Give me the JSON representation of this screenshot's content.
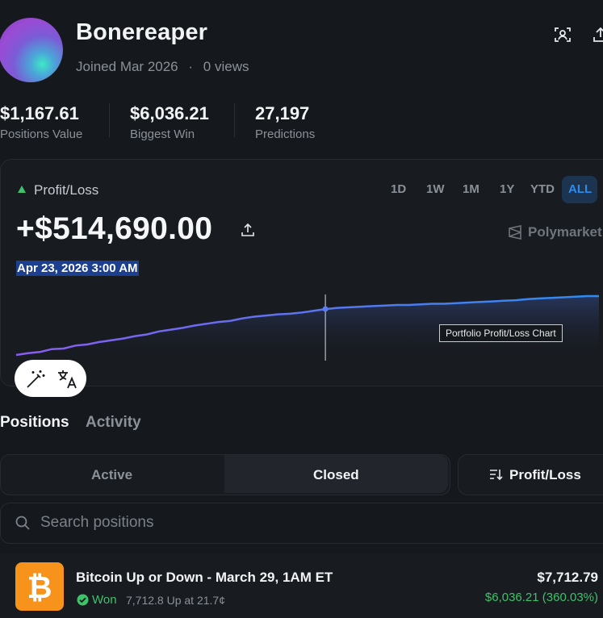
{
  "profile": {
    "username": "Bonereaper",
    "joined": "Joined Mar 2026",
    "separator": "·",
    "views": "0 views"
  },
  "stats": [
    {
      "value": "$1,167.61",
      "label": "Positions Value"
    },
    {
      "value": "$6,036.21",
      "label": "Biggest Win"
    },
    {
      "value": "27,197",
      "label": "Predictions"
    }
  ],
  "pnl_card": {
    "label": "Profit/Loss",
    "value": "+$514,690.00",
    "date": "Apr 23, 2026 3:00 AM",
    "brand": "Polymarket",
    "tooltip": "Portfolio Profit/Loss Chart",
    "ranges": [
      "1D",
      "1W",
      "1M",
      "1Y",
      "YTD",
      "ALL"
    ],
    "active_range": "ALL"
  },
  "tabs": {
    "positions": "Positions",
    "activity": "Activity"
  },
  "segments": {
    "active": "Active",
    "closed": "Closed"
  },
  "sort": {
    "label": "Profit/Loss"
  },
  "search": {
    "placeholder": "Search positions"
  },
  "positions": [
    {
      "title": "Bitcoin Up or Down - March 29, 1AM ET",
      "status": "Won",
      "detail": "7,712.8 Up at 21.7¢",
      "amount": "$7,712.79",
      "pnl": "$6,036.21 (360.03%)"
    }
  ],
  "colors": {
    "accent_green": "#3fc26a",
    "line_start": "#8a5cf0",
    "line_end": "#2d8cf0",
    "bitcoin": "#f7931a"
  },
  "chart_data": {
    "type": "line",
    "series": [
      {
        "values": [
          0,
          3,
          5,
          10,
          11,
          16,
          18,
          22,
          25,
          28,
          32,
          35,
          40,
          43,
          46,
          50,
          53,
          56,
          58,
          62,
          65,
          67,
          69,
          70,
          72,
          75,
          78,
          80,
          81,
          82,
          83,
          84,
          85,
          85,
          86,
          87,
          87,
          88,
          89,
          90,
          91,
          92,
          93,
          95,
          96,
          97,
          98,
          99,
          100,
          100
        ]
      }
    ],
    "hover_index": 26,
    "grid": false,
    "legend": "none"
  }
}
